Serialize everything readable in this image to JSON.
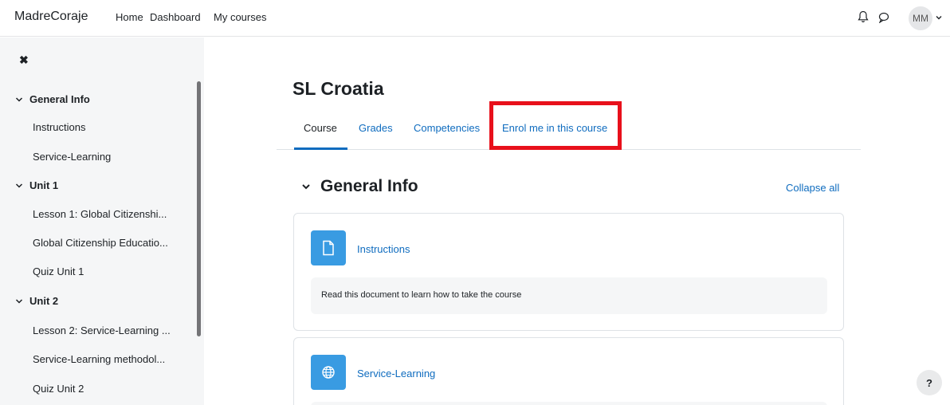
{
  "navbar": {
    "brand": "MadreCoraje",
    "links": [
      "Home",
      "Dashboard",
      "My courses"
    ],
    "avatar_initials": "MM"
  },
  "drawer": {
    "close_glyph": "✖",
    "sections": [
      {
        "title": "General Info",
        "items": [
          "Instructions",
          "Service-Learning"
        ]
      },
      {
        "title": "Unit 1",
        "items": [
          "Lesson 1: Global Citizenshi...",
          "Global Citizenship Educatio...",
          "Quiz Unit 1"
        ]
      },
      {
        "title": "Unit 2",
        "items": [
          "Lesson 2: Service-Learning ...",
          "Service-Learning methodol...",
          "Quiz Unit 2"
        ]
      }
    ]
  },
  "course": {
    "title": "SL Croatia",
    "tabs": [
      "Course",
      "Grades",
      "Competencies",
      "Enrol me in this course"
    ],
    "active_tab": "Course",
    "section_title": "General Info",
    "collapse_all": "Collapse all",
    "activities": [
      {
        "name": "Instructions",
        "icon": "file-icon",
        "description": "Read this document to learn how to take the course"
      },
      {
        "name": "Service-Learning",
        "icon": "globe-icon"
      }
    ]
  },
  "help_label": "?",
  "colors": {
    "link": "#0f6cbf",
    "highlight": "#e8101b",
    "activity_icon_bg": "#399be2",
    "drawer_bg": "#f5f6f7"
  }
}
